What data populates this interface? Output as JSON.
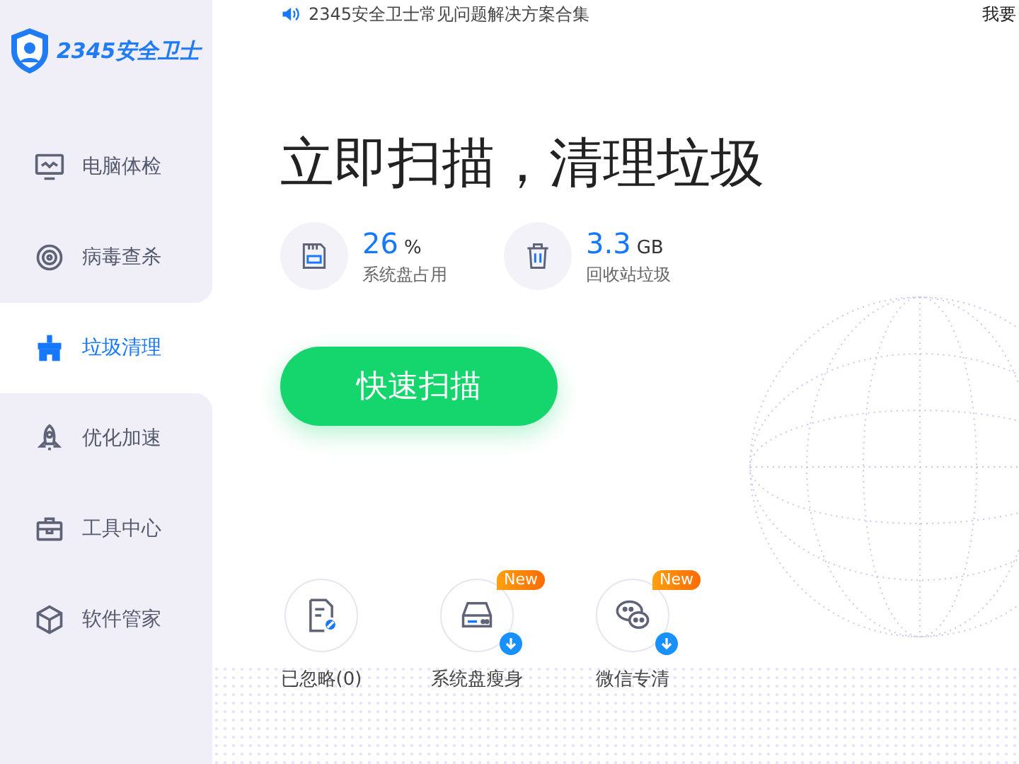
{
  "logo": {
    "text": "2345安全卫士"
  },
  "notice": {
    "text": "2345安全卫士常见问题解决方案合集"
  },
  "top_right": {
    "text": "我要"
  },
  "sidebar": {
    "items": [
      {
        "label": "电脑体检",
        "selected": false
      },
      {
        "label": "病毒查杀",
        "selected": false
      },
      {
        "label": "垃圾清理",
        "selected": true
      },
      {
        "label": "优化加速",
        "selected": false
      },
      {
        "label": "工具中心",
        "selected": false
      },
      {
        "label": "软件管家",
        "selected": false
      }
    ]
  },
  "headline": "立即扫描，清理垃圾",
  "stats": [
    {
      "value": "26",
      "unit": "%",
      "label": "系统盘占用"
    },
    {
      "value": "3.3",
      "unit": "GB",
      "label": "回收站垃圾"
    }
  ],
  "scan_button": "快速扫描",
  "tools": [
    {
      "label": "已忽略(0)",
      "download": false
    },
    {
      "label": "系统盘瘦身",
      "badge": "New",
      "download": true
    },
    {
      "label": "微信专清",
      "badge": "New",
      "download": true
    }
  ]
}
